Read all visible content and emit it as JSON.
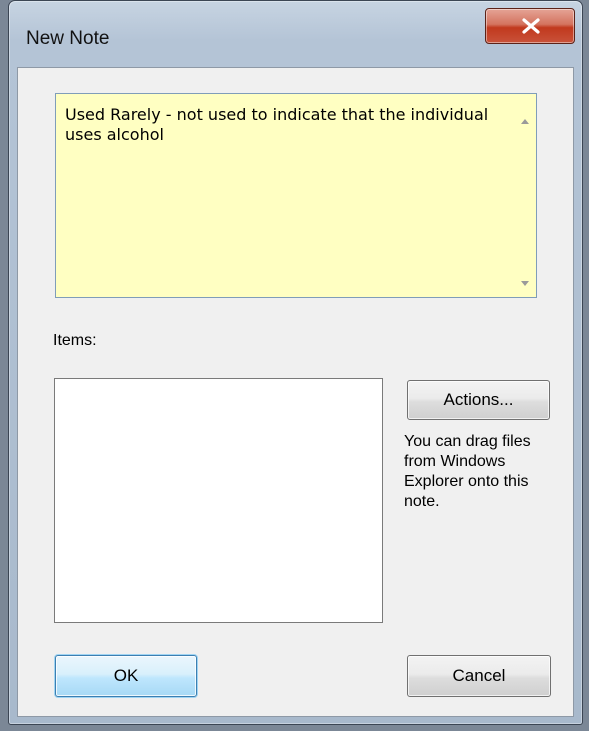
{
  "window": {
    "title": "New Note",
    "close_icon": "close-x-icon"
  },
  "note": {
    "text": "Used Rarely - not used to indicate that the individual uses alcohol",
    "background_color": "#ffffc2"
  },
  "items": {
    "label": "Items:"
  },
  "actions": {
    "button_label": "Actions...",
    "hint": "You can drag files from Windows Explorer onto this note."
  },
  "footer": {
    "ok_label": "OK",
    "cancel_label": "Cancel"
  },
  "colors": {
    "close_button": "#c1391e",
    "ok_button_border": "#3c7fb1"
  }
}
